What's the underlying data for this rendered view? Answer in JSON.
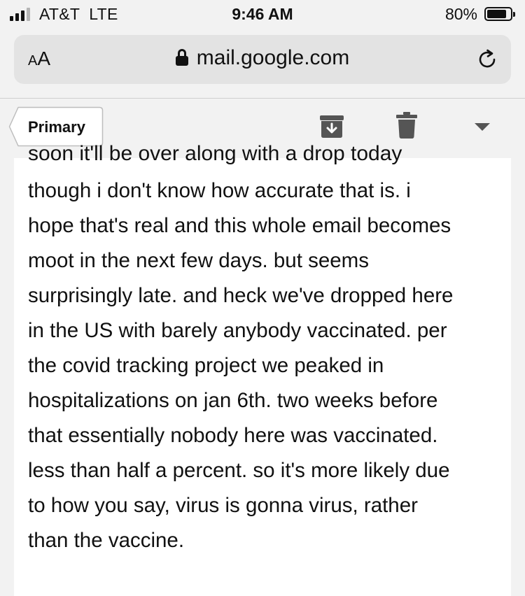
{
  "status_bar": {
    "carrier": "AT&T  LTE",
    "time": "9:46 AM",
    "battery_percent": "80%",
    "battery_level": 0.8,
    "signal_bars": 3
  },
  "url_bar": {
    "text_size_small": "A",
    "text_size_large": "A",
    "url": "mail.google.com",
    "lock_icon": "lock-icon",
    "reload_icon": "reload-icon"
  },
  "toolbar": {
    "back_label": "Primary",
    "archive_icon": "archive-icon",
    "delete_icon": "trash-icon",
    "more_icon": "chevron-down-icon"
  },
  "email": {
    "cut_off_line": "soon it'll be over along with a drop today",
    "lines": [
      "though i don't know how accurate that is. i",
      "hope that's real and this whole email becomes",
      "moot in the next few days. but seems",
      "surprisingly late. and heck we've dropped here",
      "in the US with barely anybody vaccinated. per",
      "the covid tracking project we peaked in",
      "hospitalizations on jan 6th. two weeks before",
      "that essentially nobody here was vaccinated.",
      "less than half a percent. so it's more likely due",
      "to how you say, virus is gonna virus, rather",
      "than the vaccine."
    ]
  },
  "colors": {
    "background": "#f2f2f2",
    "url_bar": "#e3e3e3",
    "card": "#ffffff",
    "text": "#111111",
    "icon": "#555555"
  }
}
